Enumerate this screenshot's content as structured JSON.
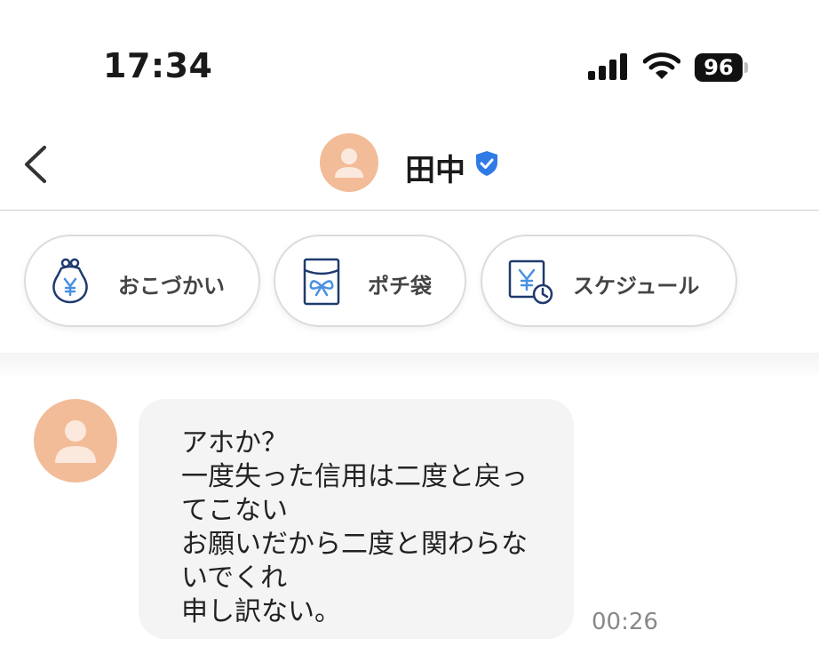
{
  "status_bar": {
    "time": "17:34",
    "battery": "96"
  },
  "header": {
    "name": "田中",
    "icons": [
      "back-chevron-icon",
      "avatar-person-icon",
      "verified-shield-icon"
    ]
  },
  "actions": [
    {
      "label": "おこづかい",
      "icon": "purse-yen-icon"
    },
    {
      "label": "ポチ袋",
      "icon": "gift-envelope-icon"
    },
    {
      "label": "スケジュール",
      "icon": "calendar-yen-clock-icon"
    }
  ],
  "messages": [
    {
      "lines": [
        "アホか？",
        "一度失った信用は二度と戻っ",
        "てこない",
        "お願いだから二度と関わらな",
        "いでくれ",
        "申し訳ない。"
      ],
      "time": "00:26"
    }
  ],
  "colors": {
    "avatar": "#f2bc98",
    "verified": "#2f7be5",
    "icon_navy": "#1f3a6e",
    "icon_blue": "#4a90e2"
  }
}
